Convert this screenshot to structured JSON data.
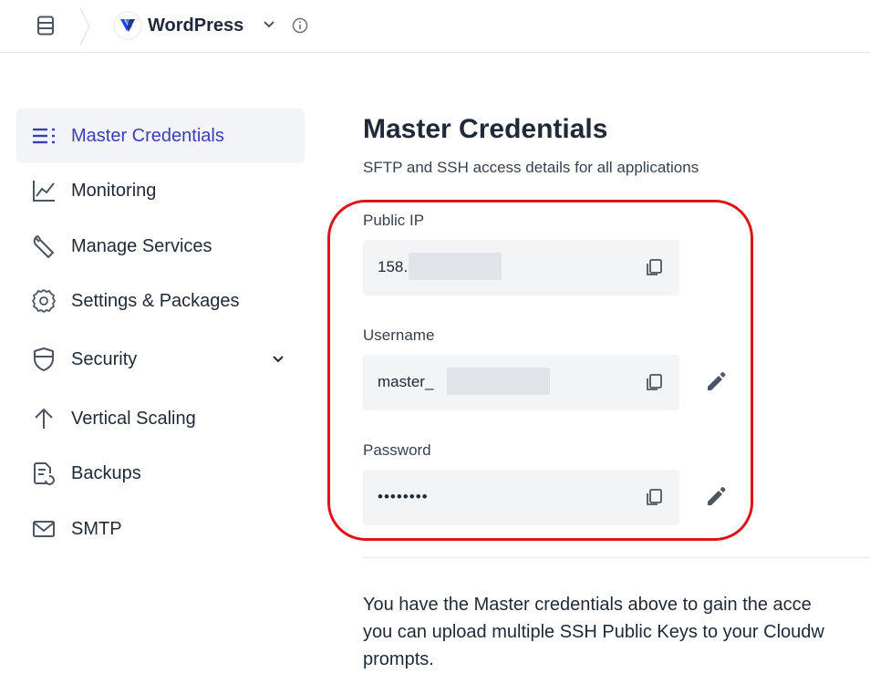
{
  "topbar": {
    "app_name": "WordPress",
    "brand_color": "#1e40ff"
  },
  "sidebar": {
    "items": [
      {
        "label": "Master Credentials",
        "icon": "list-icon",
        "active": true
      },
      {
        "label": "Monitoring",
        "icon": "chart-icon"
      },
      {
        "label": "Manage Services",
        "icon": "wrench-icon"
      },
      {
        "label": "Settings & Packages",
        "icon": "gear-icon"
      },
      {
        "label": "Security",
        "icon": "shield-icon",
        "expandable": true
      },
      {
        "label": "Vertical Scaling",
        "icon": "arrow-up-icon"
      },
      {
        "label": "Backups",
        "icon": "backup-icon"
      },
      {
        "label": "SMTP",
        "icon": "mail-icon"
      }
    ],
    "active_color": "#3b3fb5"
  },
  "main": {
    "title": "Master Credentials",
    "subtitle": "SFTP and SSH access details for all applications",
    "fields": [
      {
        "label": "Public IP",
        "value": "158.",
        "editable": false
      },
      {
        "label": "Username",
        "value": "master_",
        "editable": true
      },
      {
        "label": "Password",
        "value": "••••••••",
        "editable": true
      }
    ],
    "paragraph_lines": [
      "You have the Master credentials above to gain the acce",
      "you can upload multiple SSH Public Keys to your Cloudw",
      "prompts."
    ],
    "highlight_color": "#e0121a"
  }
}
